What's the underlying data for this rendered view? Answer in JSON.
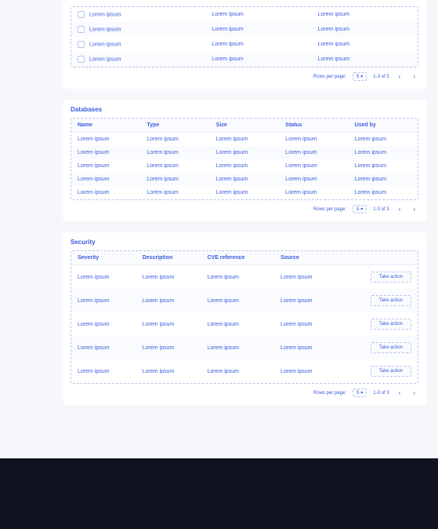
{
  "colors": {
    "primary": "#3b5bdb",
    "border": "#b8c5e8"
  },
  "first_table": {
    "rows": [
      {
        "c1": "Lorem ipsum",
        "c2": "Lorem ipsum",
        "c3": "Lorem ipsum"
      },
      {
        "c1": "Lorem ipsum",
        "c2": "Lorem ipsum",
        "c3": "Lorem ipsum"
      },
      {
        "c1": "Lorem ipsum",
        "c2": "Lorem ipsum",
        "c3": "Lorem ipsum"
      },
      {
        "c1": "Lorem ipsum",
        "c2": "Lorem ipsum",
        "c3": "Lorem ipsum"
      }
    ]
  },
  "databases": {
    "title": "Databases",
    "columns": {
      "name": "Name",
      "type": "Type",
      "size": "Size",
      "status": "Status",
      "used_by": "Used by"
    },
    "rows": [
      {
        "name": "Lorem ipsum",
        "type": "Lorem ipsum",
        "size": "Lorem ipsum",
        "status": "Lorem ipsum",
        "used_by": "Lorem ipsum"
      },
      {
        "name": "Lorem ipsum",
        "type": "Lorem ipsum",
        "size": "Lorem ipsum",
        "status": "Lorem ipsum",
        "used_by": "Lorem ipsum"
      },
      {
        "name": "Lorem ipsum",
        "type": "Lorem ipsum",
        "size": "Lorem ipsum",
        "status": "Lorem ipsum",
        "used_by": "Lorem ipsum"
      },
      {
        "name": "Lorem ipsum",
        "type": "Lorem ipsum",
        "size": "Lorem ipsum",
        "status": "Lorem ipsum",
        "used_by": "Lorem ipsum"
      },
      {
        "name": "Lorem ipsum",
        "type": "Lorem ipsum",
        "size": "Lorem ipsum",
        "status": "Lorem ipsum",
        "used_by": "Lorem ipsum"
      }
    ]
  },
  "security": {
    "title": "Security",
    "columns": {
      "severity": "Severity",
      "description": "Description",
      "cve": "CVE reference",
      "source": "Source"
    },
    "action_label": "Take action",
    "rows": [
      {
        "severity": "Lorem ipsum",
        "description": "Lorem ipsum",
        "cve": "Lorem ipsum",
        "source": "Lorem ipsum"
      },
      {
        "severity": "Lorem ipsum",
        "description": "Lorem ipsum",
        "cve": "Lorem ipsum",
        "source": "Lorem ipsum"
      },
      {
        "severity": "Lorem ipsum",
        "description": "Lorem ipsum",
        "cve": "Lorem ipsum",
        "source": "Lorem ipsum"
      },
      {
        "severity": "Lorem ipsum",
        "description": "Lorem ipsum",
        "cve": "Lorem ipsum",
        "source": "Lorem ipsum"
      },
      {
        "severity": "Lorem ipsum",
        "description": "Lorem ipsum",
        "cve": "Lorem ipsum",
        "source": "Lorem ipsum"
      }
    ]
  },
  "pagination": {
    "rows_per_page_label": "Rows per page:",
    "rows_per_page_value": "5",
    "range": "1-3 of 3"
  }
}
